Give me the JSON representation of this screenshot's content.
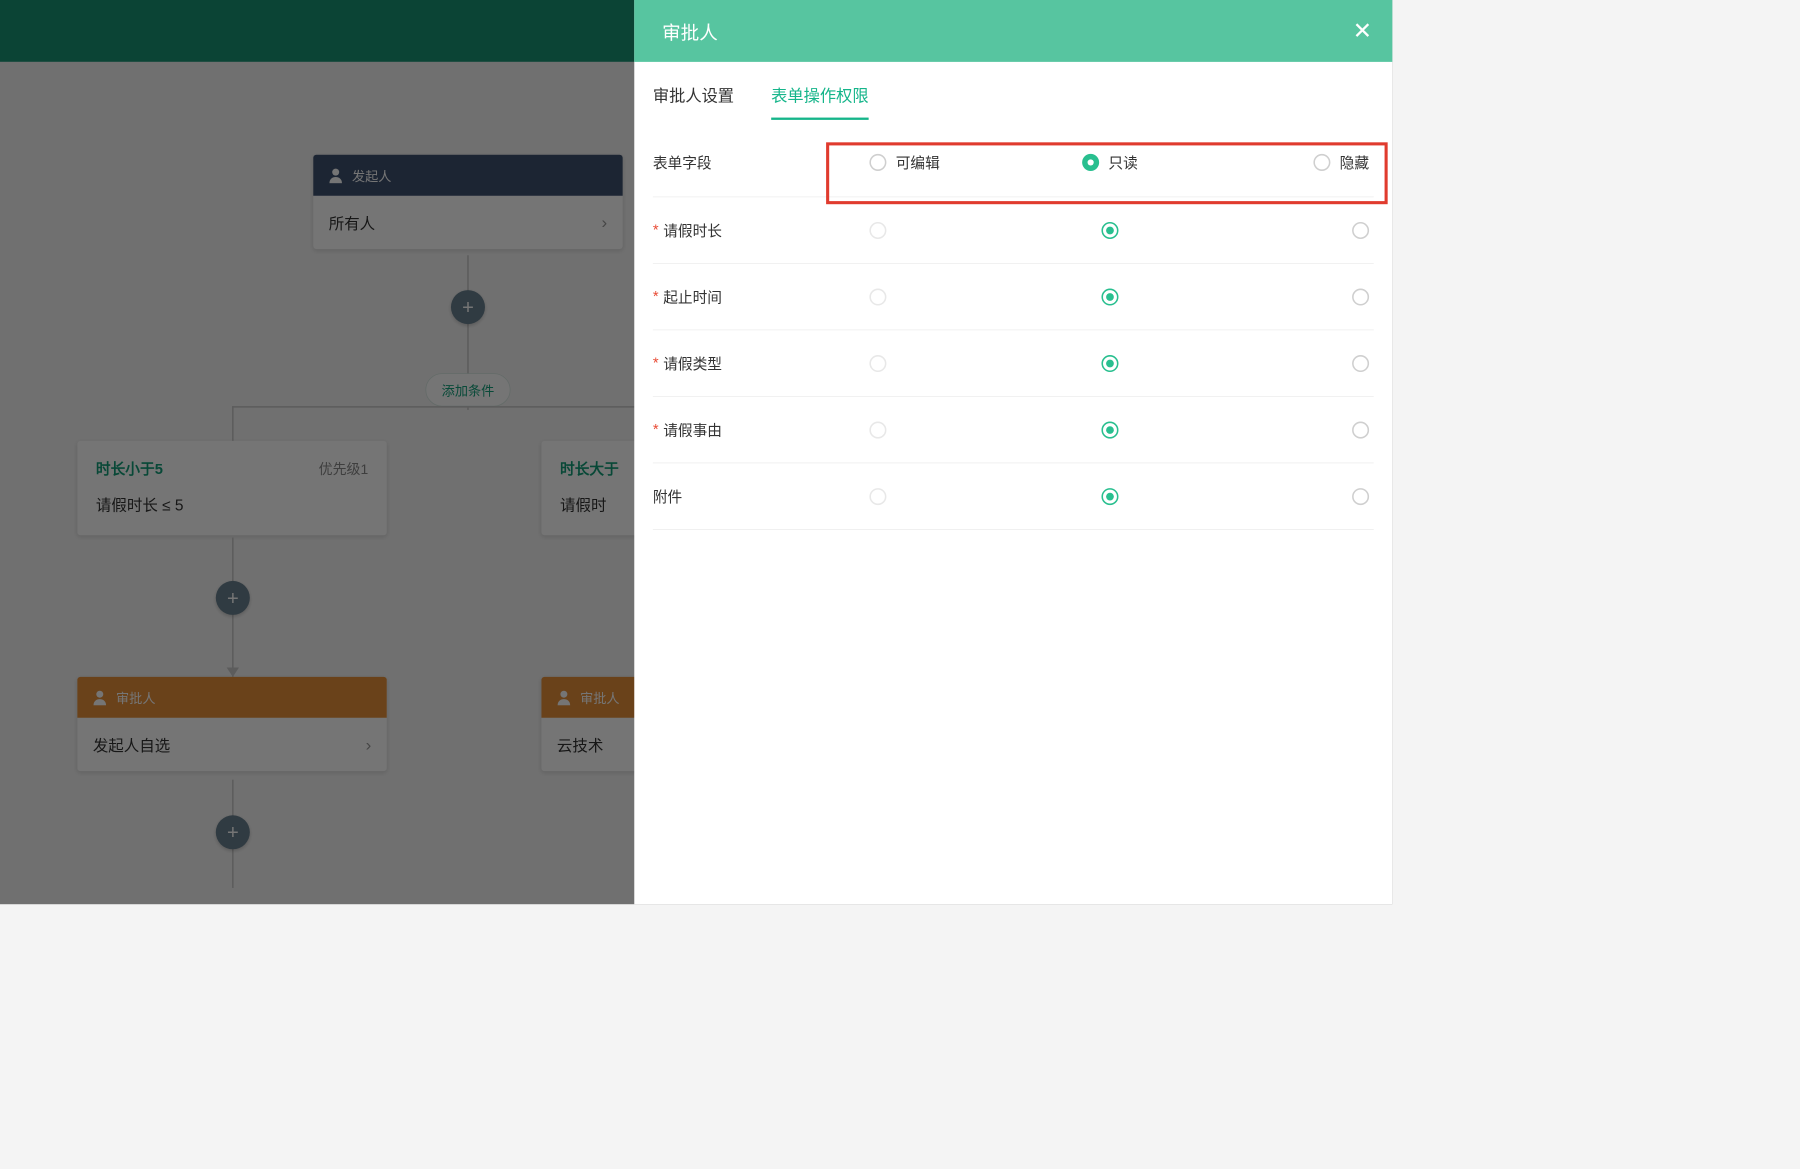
{
  "flow": {
    "initiator_header": "发起人",
    "initiator_body": "所有人",
    "add_condition": "添加条件",
    "cond_left": {
      "title": "时长小于5",
      "priority": "优先级1",
      "expr": "请假时长 ≤ 5"
    },
    "cond_right": {
      "title": "时长大于",
      "expr": "请假时"
    },
    "approver_header": "审批人",
    "approver_left_body": "发起人自选",
    "approver_right_body": "云技术"
  },
  "drawer": {
    "title": "审批人",
    "tab_settings": "审批人设置",
    "tab_perm": "表单操作权限",
    "col_label": "表单字段",
    "col_edit": "可编辑",
    "col_read": "只读",
    "col_hide": "隐藏",
    "rows": [
      {
        "label": "请假时长",
        "required": true,
        "value": "read"
      },
      {
        "label": "起止时间",
        "required": true,
        "value": "read"
      },
      {
        "label": "请假类型",
        "required": true,
        "value": "read"
      },
      {
        "label": "请假事由",
        "required": true,
        "value": "read"
      },
      {
        "label": "附件",
        "required": false,
        "value": "read"
      }
    ]
  }
}
